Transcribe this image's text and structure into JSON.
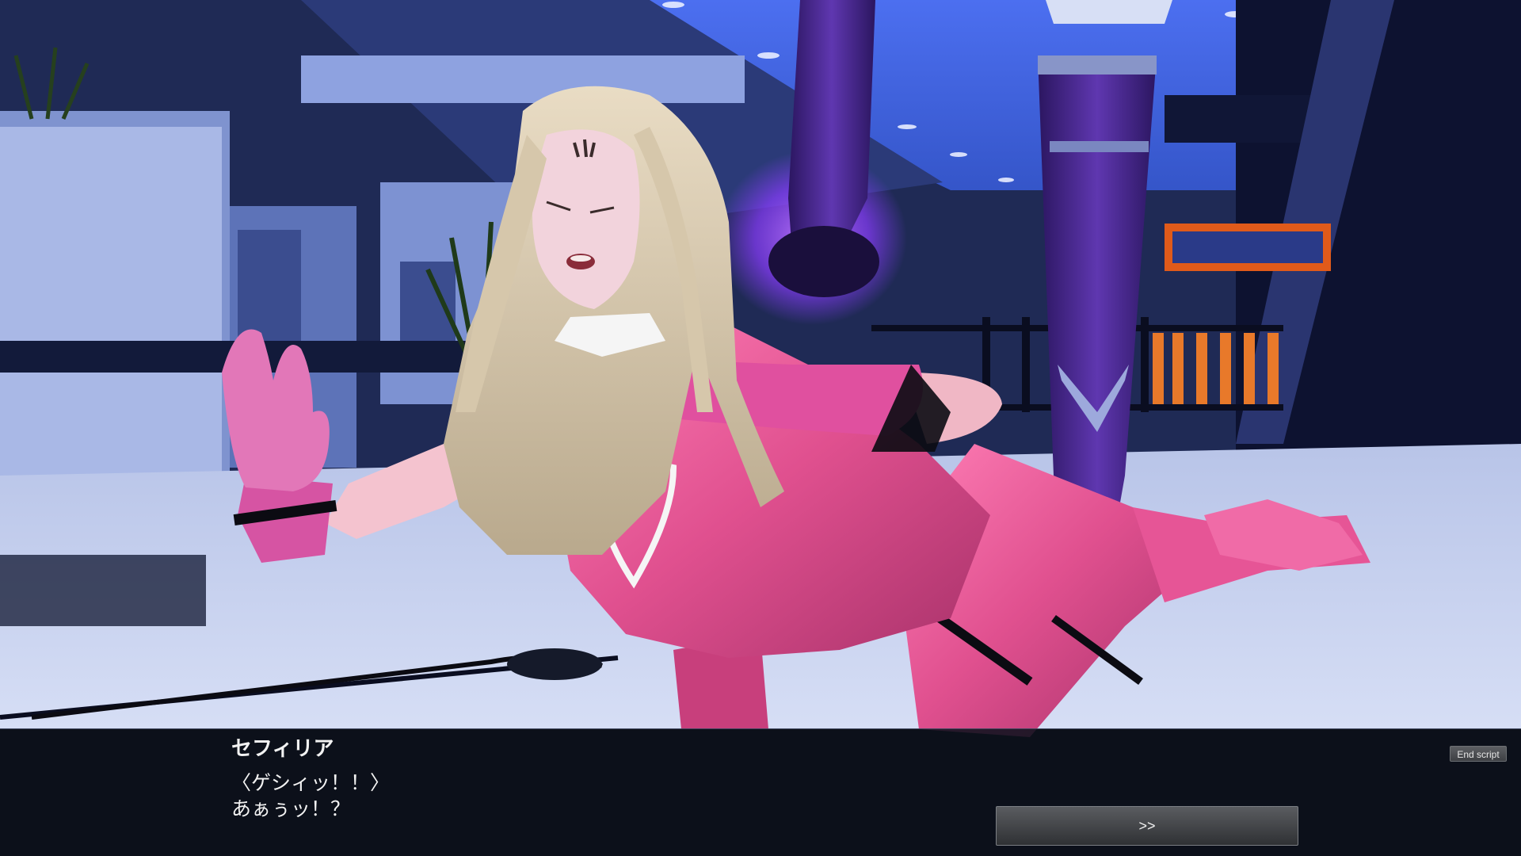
{
  "dialogue": {
    "speaker": "セフィリア",
    "lines": [
      "〈ゲシィッ！！〉",
      "あぁぅッ！？"
    ]
  },
  "controls": {
    "end_script_label": "End script",
    "next_label": ">>"
  },
  "scene": {
    "description_icon": "game-scene-render",
    "colors": {
      "sky": "#3d63e0",
      "floor": "#c9d3ee",
      "character_suit": "#e0508f",
      "boots": "#4a2a8c",
      "glow": "#8a3cff"
    }
  }
}
